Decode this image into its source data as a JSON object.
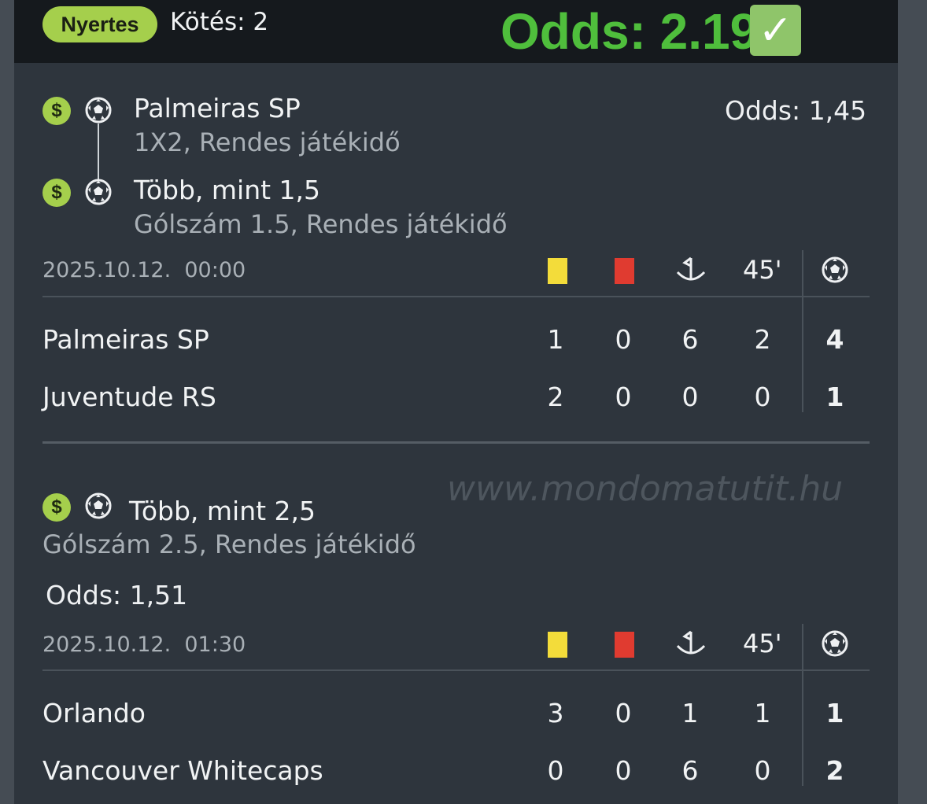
{
  "header": {
    "status_badge": "Nyertes",
    "bet_count_label": "Kötés: 2",
    "total_odds_label": "Odds: 2.19",
    "check_mark": "✓"
  },
  "bet1": {
    "selections": [
      {
        "title": "Palmeiras SP",
        "subtitle": "1X2, Rendes játékidő"
      },
      {
        "title": "Több, mint 1,5",
        "subtitle": "Gólszám 1.5, Rendes játékidő"
      }
    ],
    "odds_label": "Odds:",
    "odds_value": "1,45",
    "date": "2025.10.12.",
    "time": "00:00",
    "half_label": "45'",
    "teams": [
      {
        "name": "Palmeiras SP",
        "yellow": "1",
        "red": "0",
        "corners": "6",
        "half": "2",
        "goals": "4"
      },
      {
        "name": "Juventude RS",
        "yellow": "2",
        "red": "0",
        "corners": "0",
        "half": "0",
        "goals": "1"
      }
    ]
  },
  "bet2": {
    "selections": [
      {
        "title": "Több, mint 2,5",
        "subtitle": "Gólszám 2.5, Rendes játékidő"
      }
    ],
    "odds_label": "Odds:",
    "odds_value": "1,51",
    "date": "2025.10.12.",
    "time": "01:30",
    "half_label": "45'",
    "teams": [
      {
        "name": "Orlando",
        "yellow": "3",
        "red": "0",
        "corners": "1",
        "half": "1",
        "goals": "1"
      },
      {
        "name": "Vancouver Whitecaps",
        "yellow": "0",
        "red": "0",
        "corners": "6",
        "half": "0",
        "goals": "2"
      }
    ]
  },
  "watermark": "www.mondomatutit.hu",
  "colors": {
    "accent_green": "#a5cf4c",
    "total_odds_green": "#4fbe3c",
    "yellow_card": "#f3dc3a",
    "red_card": "#e03b30",
    "background": "#2e353d"
  },
  "icons": [
    "dollar-icon",
    "soccer-ball-icon",
    "yellow-card-icon",
    "red-card-icon",
    "corner-flag-icon"
  ]
}
